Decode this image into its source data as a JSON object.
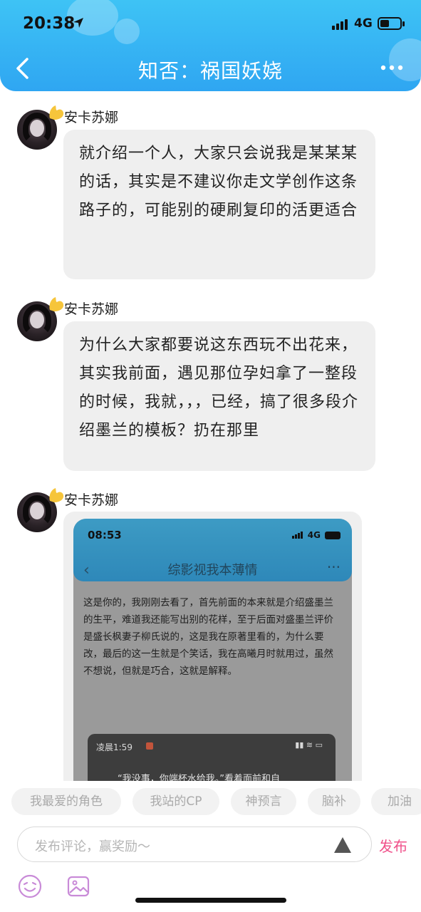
{
  "status_bar": {
    "time": "20:38",
    "network": "4G"
  },
  "nav": {
    "title": "知否：祸国妖娆",
    "back_icon": "chevron-left-icon",
    "more_icon": "more-dots-icon"
  },
  "messages": [
    {
      "username": "安卡苏娜",
      "text": "就介绍一个人，大家只会说我是某某某的话，其实是不建议你走文学创作这条路子的，可能别的硬刷复印的活更适合"
    },
    {
      "username": "安卡苏娜",
      "text": "为什么大家都要说这东西玩不出花来，其实我前面，遇见那位孕妇拿了一整段的时候，我就，，，已经，搞了很多段介绍墨兰的模板？扔在那里"
    },
    {
      "username": "安卡苏娜"
    }
  ],
  "embedded_screenshot": {
    "time": "08:53",
    "network": "4G",
    "title": "综影视我本薄情",
    "body": "这是你的，我刚刚去看了，首先前面的本来就是介绍盛墨兰的生平，难道我还能写出别的花样，至于后面对盛墨兰评价是盛长枫妻子柳氏说的，这是我在原著里看的，为什么要改，最后的这一生就是个笑话，我在高曦月时就用过，虽然不想说，但就是巧合，这就是解释。",
    "inner_time": "凌晨1:59",
    "inner_text": "“我没事，你端杯水给我。”看着面前和自"
  },
  "chips": [
    "我最爱的角色",
    "我站的CP",
    "神预言",
    "脑补",
    "加油"
  ],
  "composer": {
    "placeholder": "发布评论，赢奖励～",
    "publish_label": "发布"
  },
  "colors": {
    "header": "#2fa6f2",
    "publish": "#f0508a",
    "bubble": "#efefef"
  }
}
